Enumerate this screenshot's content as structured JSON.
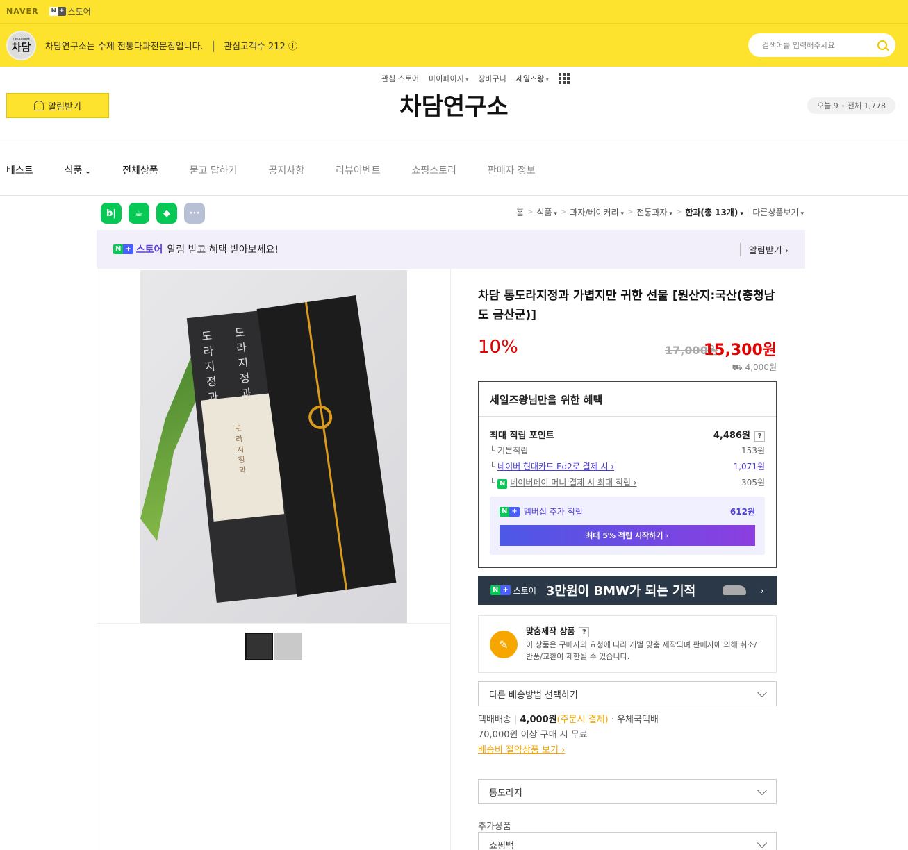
{
  "topbar": {
    "naver": "NAVER",
    "badge_n": "N",
    "badge_plus": "+",
    "store": "스토어",
    "links": [
      "관심 스토어",
      "마이페이지",
      "장바구니",
      "세일즈왕"
    ]
  },
  "storebar": {
    "logo_small": "CHADAM",
    "logo_text": "차담",
    "description": "차담연구소는 수제 전통다과전문점입니다.",
    "fans": "관심고객수 212 ⓘ",
    "search_placeholder": "검색어를 입력해주세요"
  },
  "header": {
    "alarm": "알림받기",
    "title": "차담연구소",
    "today": "오늘 9",
    "total": "전체 1,778"
  },
  "nav": [
    "베스트",
    "식품",
    "전체상품",
    "묻고 답하기",
    "공지사항",
    "리뷰이벤트",
    "쇼핑스토리",
    "판매자 정보"
  ],
  "share": {
    "blog": "b|",
    "cafe": "☕",
    "band": "◆",
    "more": "···"
  },
  "breadcrumb": {
    "home": "홈",
    "c1": "식품",
    "c2": "과자/베이커리",
    "c3": "전통과자",
    "c4": "한과(총 13개)",
    "other": "다른상품보기"
  },
  "promo": {
    "store": "스토어",
    "text": "알림 받고 혜택 받아보세요!",
    "action": "알림받기 ›"
  },
  "photo": {
    "pack_text1": "도라지정과",
    "pack_text2": "도라지정과",
    "band_text": "도라지정과"
  },
  "product": {
    "title": "차담 통도라지정과 가볍지만 귀한 선물 [원산지:국산(충청남도 금산군)]",
    "discount": "10%",
    "original": "17,000원",
    "price": "15,300원",
    "shipping_fee": "4,000원"
  },
  "benefit": {
    "header": "세일즈왕님만을 위한 혜택",
    "max_label": "최대 적립 포인트",
    "max_value": "4,486원",
    "q": "?",
    "basic_label": "기본적립",
    "basic_value": "153원",
    "card_label": "네이버 현대카드 Ed2로 결제 시 ›",
    "card_value": "1,071원",
    "pay_label": "네이버페이 머니 결제 시 최대 적립 ›",
    "pay_value": "305원",
    "member_label": "멤버십 추가 적립",
    "member_value": "612원",
    "member_button": "최대 5% 적립 시작하기 ›"
  },
  "bmw": {
    "store": "스토어",
    "text": "3만원이 BMW가 되는 기적",
    "chev": "›"
  },
  "custom": {
    "title": "맞춤제작 상품",
    "q": "?",
    "desc": "이 상품은 구매자의 요청에 따라 개별 맞춤 제작되며 판매자에 의해 취소/반품/교환이 제한될 수 있습니다."
  },
  "delivery": {
    "select": "다른 배송방법 선택하기",
    "type": "택배배송",
    "fee": "4,000원",
    "pay": "(주문시 결제)",
    "carrier": "· 우체국택배",
    "free": "70,000원 이상 구매 시 무료",
    "saving": "배송비 절약상품 보기 ›"
  },
  "options": {
    "option1": "통도라지",
    "add_label": "추가상품",
    "option2": "쇼핑백"
  },
  "colors": {
    "yellow": "#fde22e",
    "red": "#e50000",
    "purple": "#4b3bd9",
    "orange": "#f7a600"
  }
}
